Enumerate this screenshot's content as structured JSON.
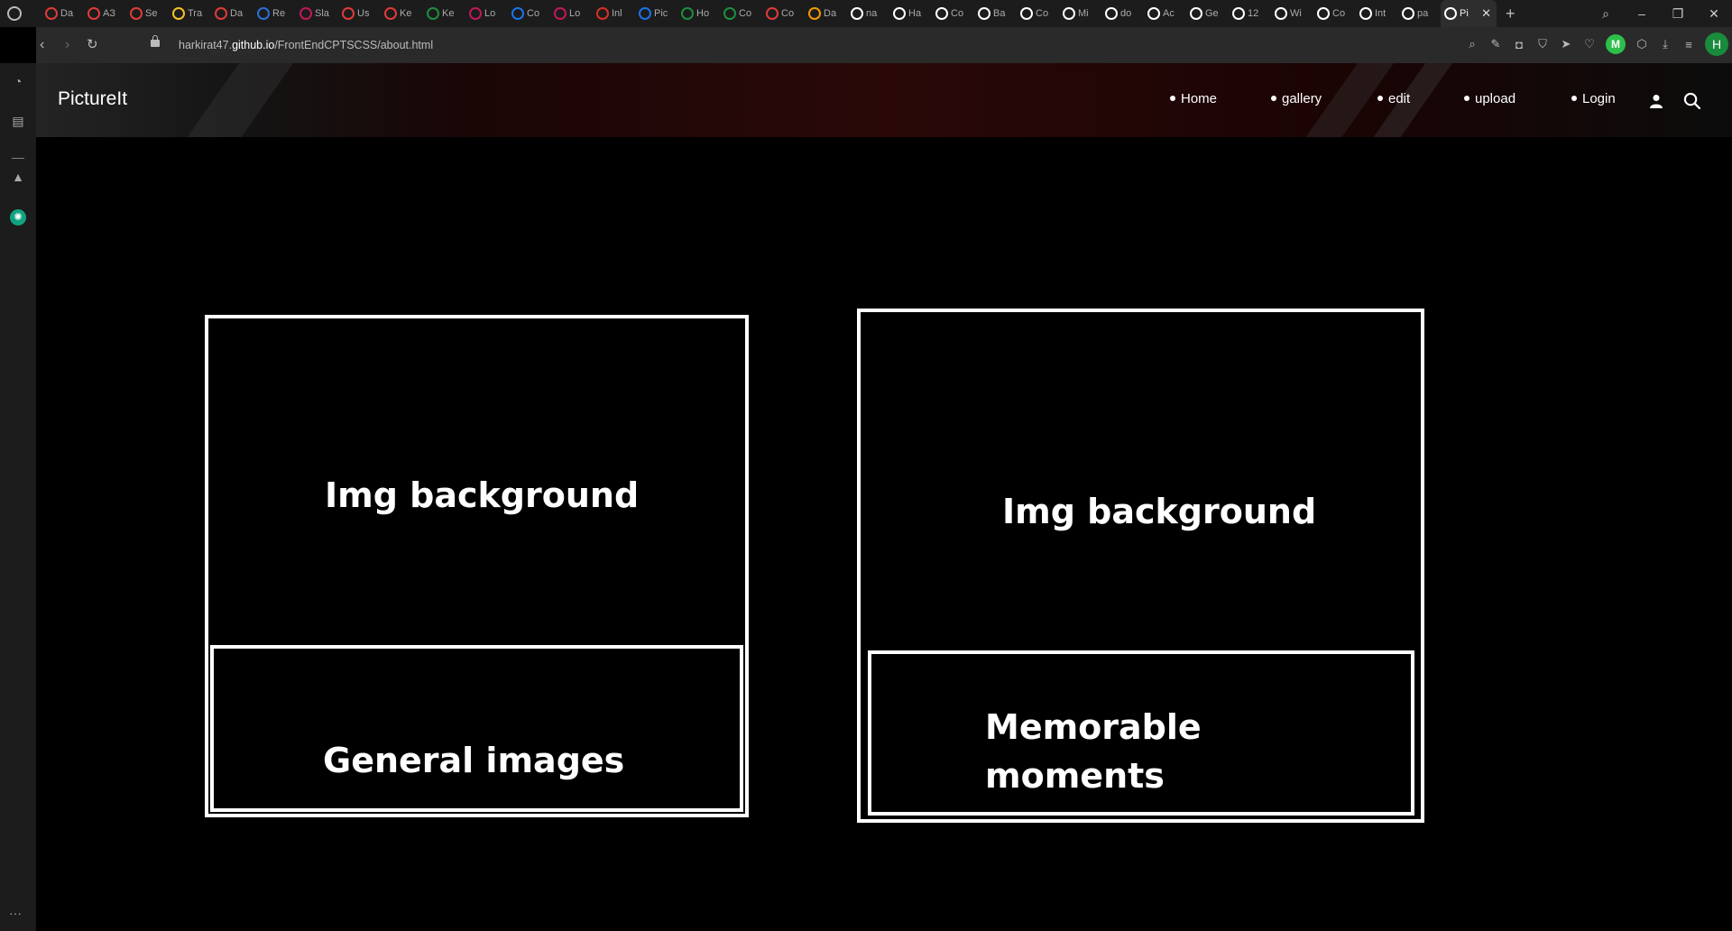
{
  "browser": {
    "tabs": [
      {
        "label": "Da",
        "color": "#e03b3b"
      },
      {
        "label": "AЗ",
        "color": "#e03b3b"
      },
      {
        "label": "Se",
        "color": "#e03b3b"
      },
      {
        "label": "Tra",
        "color": "#f6c026"
      },
      {
        "label": "Da",
        "color": "#e03b3b"
      },
      {
        "label": "Re",
        "color": "#2b6fd6"
      },
      {
        "label": "Sla",
        "color": "#c2185b"
      },
      {
        "label": "Us",
        "color": "#e03b3b"
      },
      {
        "label": "Ke",
        "color": "#e03b3b"
      },
      {
        "label": "Ke",
        "color": "#1e8e3e"
      },
      {
        "label": "Lo",
        "color": "#c2185b"
      },
      {
        "label": "Co",
        "color": "#1a73e8"
      },
      {
        "label": "Lo",
        "color": "#c2185b"
      },
      {
        "label": "Inl",
        "color": "#d93025"
      },
      {
        "label": "Pic",
        "color": "#1a73e8"
      },
      {
        "label": "Ho",
        "color": "#1e8e3e"
      },
      {
        "label": "Co",
        "color": "#1e8e3e"
      },
      {
        "label": "Co",
        "color": "#e03b3b"
      },
      {
        "label": "Da",
        "color": "#f29900"
      },
      {
        "label": "na",
        "color": "#ffffff"
      },
      {
        "label": "Ha",
        "color": "#ffffff"
      },
      {
        "label": "Co",
        "color": "#ffffff"
      },
      {
        "label": "Ba",
        "color": "#ffffff"
      },
      {
        "label": "Co",
        "color": "#ffffff"
      },
      {
        "label": "Mi",
        "color": "#ffffff"
      },
      {
        "label": "do",
        "color": "#ffffff"
      },
      {
        "label": "Ac",
        "color": "#ffffff"
      },
      {
        "label": "Ge",
        "color": "#ffffff"
      },
      {
        "label": "12",
        "color": "#ffffff"
      },
      {
        "label": "Wi",
        "color": "#ffffff"
      },
      {
        "label": "Co",
        "color": "#ffffff"
      },
      {
        "label": "Int",
        "color": "#ffffff"
      },
      {
        "label": "pa",
        "color": "#ffffff"
      }
    ],
    "active_tab": {
      "label": "Pi"
    },
    "new_tab_label": "+",
    "window": {
      "minimize": "–",
      "restore": "❐",
      "close": "✕"
    },
    "url_prefix": "harkirat47.",
    "url_domain": "github.io",
    "url_path": "/FrontEndCPTSCSS/about.html",
    "avatar_letter": "H",
    "extension_letter": "M"
  },
  "site": {
    "brand": "PictureIt",
    "nav": [
      "Home",
      "gallery",
      "edit",
      "upload",
      "Login"
    ],
    "accent": "#ffffff",
    "background": "#000000"
  },
  "cards": [
    {
      "title": "Img background",
      "caption": "General images"
    },
    {
      "title": "Img background",
      "caption_line1": "Memorable",
      "caption_line2": "moments"
    }
  ]
}
